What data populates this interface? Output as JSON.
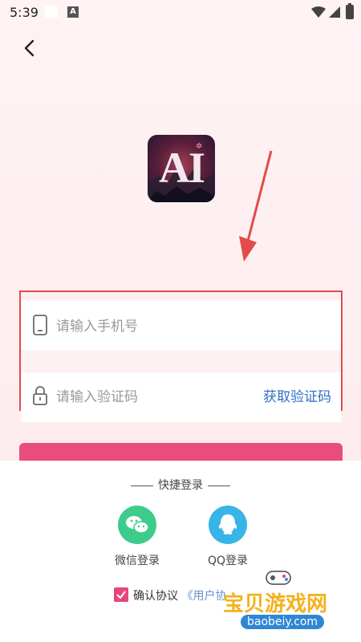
{
  "status_bar": {
    "time": "5:39",
    "a_badge": "A"
  },
  "form": {
    "phone_placeholder": "请输入手机号",
    "code_placeholder": "请输入验证码",
    "get_code_label": "获取验证码"
  },
  "logo": {
    "text": "AI"
  },
  "quick_login": {
    "title": "快捷登录",
    "wechat_label": "微信登录",
    "qq_label": "QQ登录"
  },
  "agreement": {
    "prefix": "确认协议",
    "link": "《用户协"
  },
  "watermark": {
    "title": "宝贝游戏网",
    "domain": "baobeiy.com"
  },
  "colors": {
    "login_button": "#ea4c7d",
    "link_blue": "#2f6ec9",
    "highlight_border": "#e54a4a",
    "wechat_green": "#3dcc8c",
    "qq_blue": "#38b4e8"
  }
}
